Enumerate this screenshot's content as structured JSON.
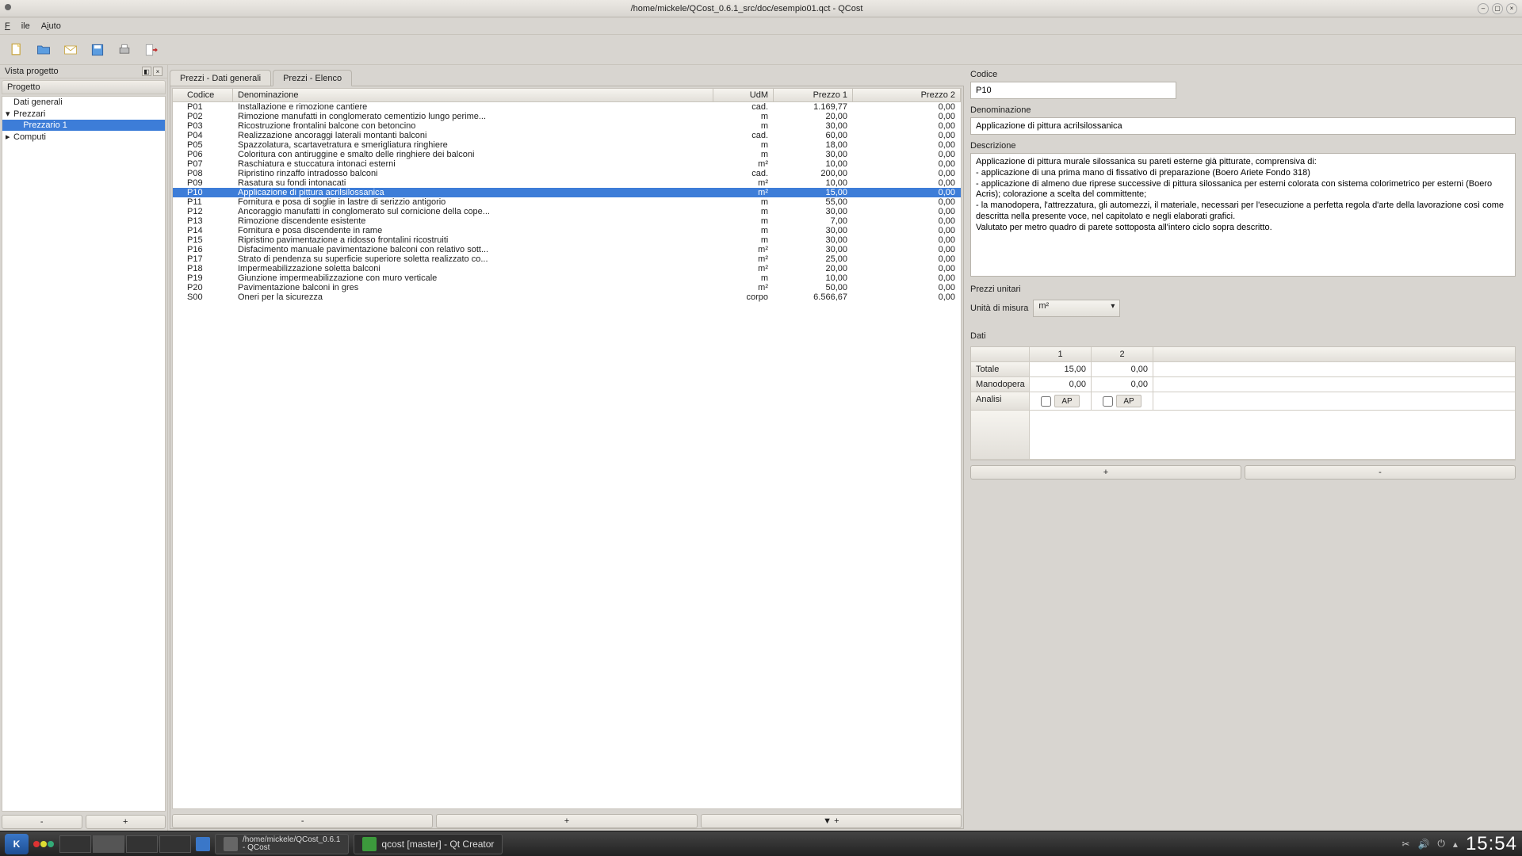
{
  "window": {
    "title": "/home/mickele/QCost_0.6.1_src/doc/esempio01.qct - QCost"
  },
  "menu": {
    "file": "File",
    "help": "Aiuto"
  },
  "left": {
    "viewTitle": "Vista progetto",
    "header": "Progetto",
    "tree": [
      {
        "label": "Dati generali",
        "level": 1
      },
      {
        "label": "Prezzari",
        "level": 1,
        "expander": "▾"
      },
      {
        "label": "Prezzario 1",
        "level": 2,
        "selected": true
      },
      {
        "label": "Computi",
        "level": 1,
        "expander": "▸"
      }
    ],
    "minus": "-",
    "plus": "+"
  },
  "tabs": {
    "t1": "Prezzi - Dati generali",
    "t2": "Prezzi - Elenco"
  },
  "grid": {
    "h_codice": "Codice",
    "h_den": "Denominazione",
    "h_udm": "UdM",
    "h_p1": "Prezzo 1",
    "h_p2": "Prezzo 2",
    "rows": [
      {
        "c": "P01",
        "d": "Installazione e rimozione cantiere",
        "u": "cad.",
        "p1": "1.169,77",
        "p2": "0,00"
      },
      {
        "c": "P02",
        "d": "Rimozione manufatti in conglomerato cementizio lungo perime...",
        "u": "m",
        "p1": "20,00",
        "p2": "0,00"
      },
      {
        "c": "P03",
        "d": "Ricostruzione frontalini balcone con betoncino",
        "u": "m",
        "p1": "30,00",
        "p2": "0,00"
      },
      {
        "c": "P04",
        "d": "Realizzazione ancoraggi laterali montanti balconi",
        "u": "cad.",
        "p1": "60,00",
        "p2": "0,00"
      },
      {
        "c": "P05",
        "d": "Spazzolatura, scartavetratura e smerigliatura ringhiere",
        "u": "m",
        "p1": "18,00",
        "p2": "0,00"
      },
      {
        "c": "P06",
        "d": "Coloritura con antiruggine e smalto delle ringhiere dei balconi",
        "u": "m",
        "p1": "30,00",
        "p2": "0,00"
      },
      {
        "c": "P07",
        "d": "Raschiatura e stuccatura intonaci esterni",
        "u": "m²",
        "p1": "10,00",
        "p2": "0,00"
      },
      {
        "c": "P08",
        "d": "Ripristino rinzaffo intradosso balconi",
        "u": "cad.",
        "p1": "200,00",
        "p2": "0,00"
      },
      {
        "c": "P09",
        "d": "Rasatura su fondi intonacati",
        "u": "m²",
        "p1": "10,00",
        "p2": "0,00"
      },
      {
        "c": "P10",
        "d": "Applicazione di pittura acrilsilossanica",
        "u": "m²",
        "p1": "15,00",
        "p2": "0,00",
        "sel": true
      },
      {
        "c": "P11",
        "d": "Fornitura e posa di soglie in lastre di serizzio antigorio",
        "u": "m",
        "p1": "55,00",
        "p2": "0,00"
      },
      {
        "c": "P12",
        "d": "Ancoraggio manufatti in conglomerato sul cornicione della cope...",
        "u": "m",
        "p1": "30,00",
        "p2": "0,00"
      },
      {
        "c": "P13",
        "d": "Rimozione discendente esistente",
        "u": "m",
        "p1": "7,00",
        "p2": "0,00"
      },
      {
        "c": "P14",
        "d": "Fornitura e posa discendente in rame",
        "u": "m",
        "p1": "30,00",
        "p2": "0,00"
      },
      {
        "c": "P15",
        "d": "Ripristino pavimentazione a ridosso frontalini ricostruiti",
        "u": "m",
        "p1": "30,00",
        "p2": "0,00"
      },
      {
        "c": "P16",
        "d": "Disfacimento manuale pavimentazione balconi con relativo sott...",
        "u": "m²",
        "p1": "30,00",
        "p2": "0,00"
      },
      {
        "c": "P17",
        "d": "Strato di pendenza su superficie superiore soletta realizzato co...",
        "u": "m²",
        "p1": "25,00",
        "p2": "0,00"
      },
      {
        "c": "P18",
        "d": "Impermeabilizzazione soletta balconi",
        "u": "m²",
        "p1": "20,00",
        "p2": "0,00"
      },
      {
        "c": "P19",
        "d": "Giunzione impermeabilizzazione con muro verticale",
        "u": "m",
        "p1": "10,00",
        "p2": "0,00"
      },
      {
        "c": "P20",
        "d": "Pavimentazione balconi in gres",
        "u": "m²",
        "p1": "50,00",
        "p2": "0,00"
      },
      {
        "c": "S00",
        "d": "Oneri per la sicurezza",
        "u": "corpo",
        "p1": "6.566,67",
        "p2": "0,00"
      }
    ],
    "minus": "-",
    "plus": "+",
    "down": "▼ +"
  },
  "right": {
    "codice_lbl": "Codice",
    "codice_val": "P10",
    "den_lbl": "Denominazione",
    "den_val": "Applicazione di pittura acrilsilossanica",
    "descr_lbl": "Descrizione",
    "descr_val": "Applicazione di pittura murale silossanica su pareti esterne già pitturate, comprensiva di:\n- applicazione di una prima mano di fissativo di preparazione (Boero Ariete Fondo 318)\n- applicazione di almeno due riprese successive di pittura silossanica per esterni colorata con sistema colorimetrico per esterni (Boero Acris); colorazione a scelta del committente;\n- la manodopera, l'attrezzatura, gli automezzi, il materiale, necessari per l'esecuzione a perfetta regola d'arte della lavorazione così come descritta nella presente voce, nel capitolato e negli elaborati grafici.\nValutato per metro quadro di parete sottoposta all'intero ciclo sopra descritto.",
    "pu_lbl": "Prezzi unitari",
    "udm_lbl": "Unità di misura",
    "udm_val": "m²",
    "dati_lbl": "Dati",
    "h1": "1",
    "h2": "2",
    "totale_lbl": "Totale",
    "totale_1": "15,00",
    "totale_2": "0,00",
    "mano_lbl": "Manodopera",
    "mano_1": "0,00",
    "mano_2": "0,00",
    "analisi_lbl": "Analisi",
    "ap": "AP",
    "plus": "+",
    "minus": "-"
  },
  "taskbar": {
    "t1a": "/home/mickele/QCost_0.6.1",
    "t1b": "- QCost",
    "t2": "qcost [master] - Qt Creator",
    "clock": "15:54"
  }
}
